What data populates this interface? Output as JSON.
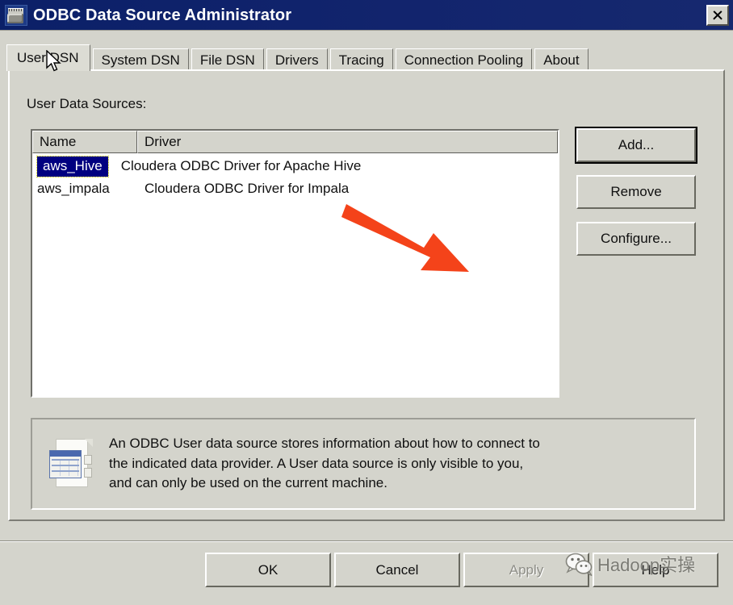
{
  "window": {
    "title": "ODBC Data Source Administrator",
    "icon": "odbc-app-icon",
    "close_label": "✕"
  },
  "tabs": [
    {
      "label": "User DSN",
      "active": true
    },
    {
      "label": "System DSN",
      "active": false
    },
    {
      "label": "File DSN",
      "active": false
    },
    {
      "label": "Drivers",
      "active": false
    },
    {
      "label": "Tracing",
      "active": false
    },
    {
      "label": "Connection Pooling",
      "active": false
    },
    {
      "label": "About",
      "active": false
    }
  ],
  "main": {
    "section_label": "User Data Sources:",
    "list": {
      "columns": [
        "Name",
        "Driver"
      ],
      "rows": [
        {
          "name": "aws_Hive",
          "driver": "Cloudera ODBC Driver for Apache Hive",
          "selected": true
        },
        {
          "name": "aws_impala",
          "driver": "Cloudera ODBC Driver for Impala",
          "selected": false
        }
      ]
    },
    "side_buttons": [
      {
        "label": "Add...",
        "default": true,
        "disabled": false
      },
      {
        "label": "Remove",
        "default": false,
        "disabled": false
      },
      {
        "label": "Configure...",
        "default": false,
        "disabled": false
      }
    ],
    "info": {
      "icon": "odbc-data-source-icon",
      "text": "An ODBC User data source stores information about how to connect to\nthe indicated data provider.   A User data source is only visible to you,\nand can only be used on the current machine."
    }
  },
  "footer": {
    "buttons": [
      {
        "label": "OK",
        "disabled": false
      },
      {
        "label": "Cancel",
        "disabled": false
      },
      {
        "label": "Apply",
        "disabled": true
      },
      {
        "label": "Help",
        "disabled": false
      }
    ]
  },
  "annotation": {
    "arrow_color": "#F4431A",
    "arrow_description": "orange arrow pointing from the driver list toward the lower right"
  },
  "watermark": {
    "text": "Hadoop实操",
    "logo": "wechat-logo",
    "color": "#6F6F68"
  },
  "cursor": {
    "type": "arrow-pointer"
  },
  "colors": {
    "titlebar": "#12246D",
    "dialog_face": "#D4D4CC",
    "selection": "#000080",
    "accent_arrow": "#F4431A"
  }
}
